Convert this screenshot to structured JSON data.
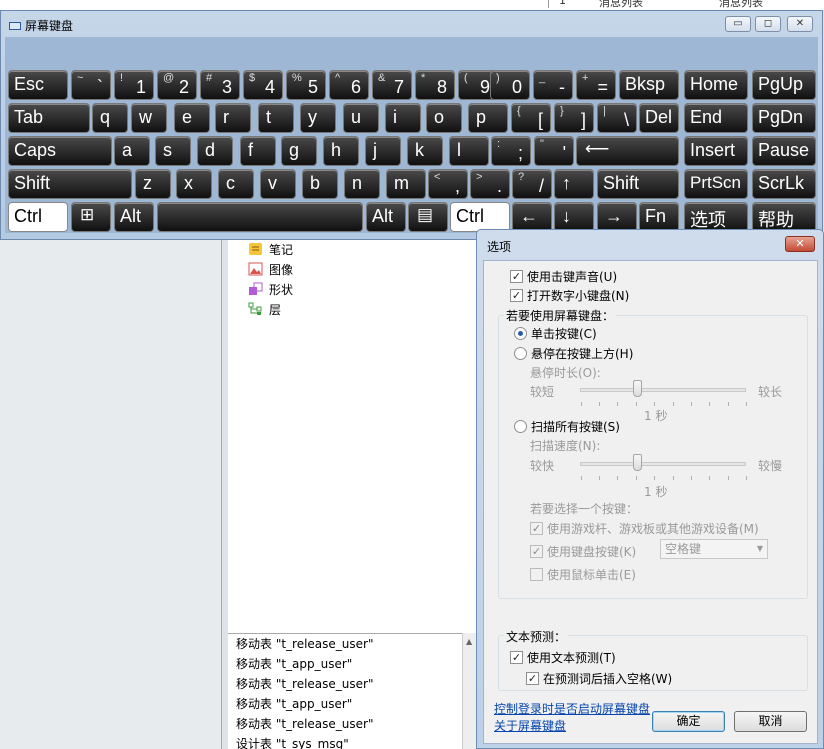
{
  "background": {
    "top_grid": [
      "1",
      "消息列表",
      "消息列表"
    ],
    "tree": [
      {
        "label": "笔记",
        "icon": "note-icon",
        "color": "#f7c53b"
      },
      {
        "label": "图像",
        "icon": "image-icon",
        "color": "#d9534f"
      },
      {
        "label": "形状",
        "icon": "shape-icon",
        "color": "#b05cd6"
      },
      {
        "label": "层",
        "icon": "layer-icon",
        "color": "#3d9b3d"
      }
    ],
    "log": [
      "移动表 \"t_release_user\"",
      "移动表 \"t_app_user\"",
      "移动表 \"t_release_user\"",
      "移动表 \"t_app_user\"",
      "移动表 \"t_release_user\"",
      "设计表 \"t_sys_msg\""
    ]
  },
  "osk": {
    "title": "屏幕键盘",
    "window_buttons": {
      "minimize": "▭",
      "maximize": "◻",
      "close": "✕"
    },
    "keys": {
      "esc": "Esc",
      "tilde_top": "~",
      "tilde_bot": "`",
      "k1_top": "!",
      "k1": "1",
      "k2_top": "@",
      "k2": "2",
      "k3_top": "#",
      "k3": "3",
      "k4_top": "$",
      "k4": "4",
      "k5_top": "%",
      "k5": "5",
      "k6_top": "^",
      "k6": "6",
      "k7_top": "&",
      "k7": "7",
      "k8_top": "*",
      "k8": "8",
      "k9_top": "(",
      "k9": "9",
      "k0_top": ")",
      "k0": "0",
      "minus_top": "_",
      "minus": "-",
      "equal_top": "+",
      "equal": "=",
      "bksp": "Bksp",
      "home": "Home",
      "pgup": "PgUp",
      "tab": "Tab",
      "q": "q",
      "w": "w",
      "e": "e",
      "r": "r",
      "t": "t",
      "y": "y",
      "u": "u",
      "i": "i",
      "o": "o",
      "p": "p",
      "lbr_top": "{",
      "lbr": "[",
      "rbr_top": "}",
      "rbr": "]",
      "bsl_top": "|",
      "bsl": "\\",
      "del": "Del",
      "end": "End",
      "pgdn": "PgDn",
      "caps": "Caps",
      "a": "a",
      "s": "s",
      "d": "d",
      "f": "f",
      "g": "g",
      "h": "h",
      "j": "j",
      "k": "k",
      "l": "l",
      "semi_top": ":",
      "semi": ";",
      "quote_top": "\"",
      "quote": "'",
      "enter": "⟵",
      "insert": "Insert",
      "pause": "Pause",
      "shift": "Shift",
      "z": "z",
      "x": "x",
      "c": "c",
      "v": "v",
      "b": "b",
      "n": "n",
      "m": "m",
      "comma_top": "<",
      "comma": ",",
      "period_top": ">",
      "period": ".",
      "slash_top": "?",
      "slash": "/",
      "up": "↑",
      "shift_r": "Shift",
      "prtscn": "PrtScn",
      "scrlk": "ScrLk",
      "ctrl": "Ctrl",
      "win": "⊞",
      "alt": "Alt",
      "space": "",
      "alt_r": "Alt",
      "menu": "▤",
      "ctrl_r": "Ctrl",
      "left": "←",
      "down": "↓",
      "right": "→",
      "fn": "Fn",
      "options": "选项",
      "help": "帮助"
    }
  },
  "dialog": {
    "title": "选项",
    "close": "✕",
    "use_click_sound": "使用击键声音(U)",
    "turn_on_numpad": "打开数字小键盘(N)",
    "group_title": "若要使用屏幕键盘：",
    "click_keys": "单击按键(C)",
    "hover_keys": "悬停在按键上方(H)",
    "hover_duration": "悬停时长(O):",
    "shorter": "较短",
    "longer": "较长",
    "hover_value": "1 秒",
    "scan_keys": "扫描所有按键(S)",
    "scan_speed": "扫描速度(N):",
    "faster": "较快",
    "slower": "较慢",
    "scan_value": "1 秒",
    "select_key_text": "若要选择一个按键：",
    "use_joystick": "使用游戏杆、游戏板或其他游戏设备(M)",
    "use_keyboard_key": "使用键盘按键(K)",
    "keyboard_key_value": "空格键",
    "use_mouse_click": "使用鼠标单击(E)",
    "text_prediction_title": "文本预测：",
    "use_text_prediction": "使用文本预测(T)",
    "insert_space": "在预测词后插入空格(W)",
    "link_logon": "控制登录时是否启动屏幕键盘",
    "link_about": "关于屏幕键盘",
    "ok": "确定",
    "cancel": "取消",
    "check": "✓"
  }
}
